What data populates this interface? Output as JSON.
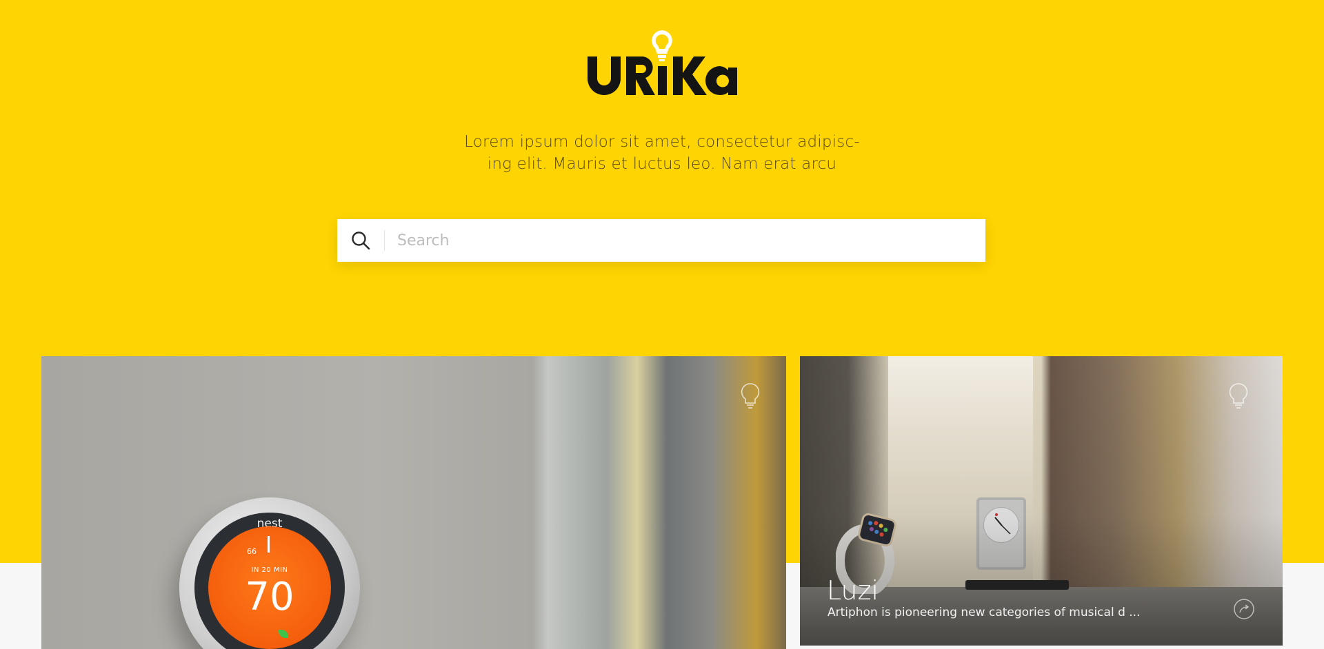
{
  "brand": {
    "logo_text": "URiKA",
    "tagline_line1": "Lorem ipsum dolor sit amet, consectetur adipisc-",
    "tagline_line2": "ing elit. Mauris et luctus leo. Nam erat arcu"
  },
  "search": {
    "placeholder": "Search",
    "value": ""
  },
  "cards": [
    {
      "thermostat_brand": "nest",
      "thermostat_sub": "IN 20 MIN",
      "thermostat_temp": "70",
      "thermostat_target": "66",
      "icon": "bulb-icon"
    },
    {
      "title": "Luzi",
      "description": "Artiphon is pioneering new categories of musical d ...",
      "icon": "bulb-icon",
      "action_icon": "share-icon"
    }
  ],
  "colors": {
    "hero_bg": "#fed402",
    "page_bg": "#f7f7f7",
    "text_dark": "#5a4a18"
  }
}
